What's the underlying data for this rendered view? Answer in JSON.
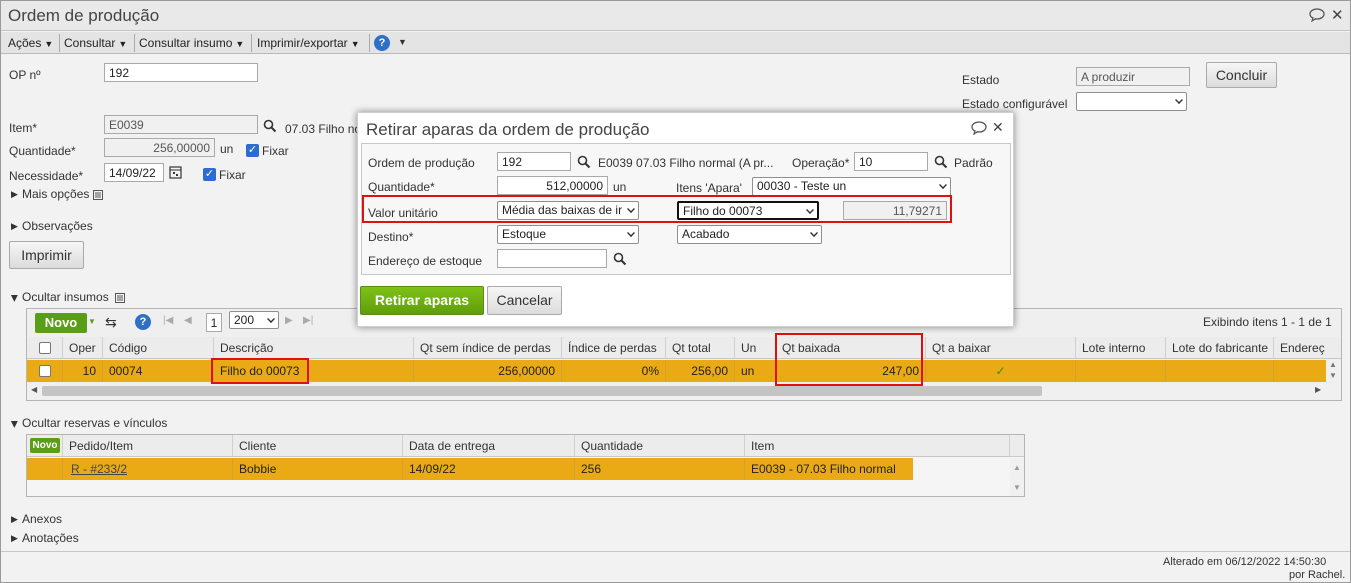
{
  "window": {
    "title": "Ordem de produção"
  },
  "menu": [
    {
      "label": "Ações"
    },
    {
      "label": "Consultar"
    },
    {
      "label": "Consultar insumo"
    },
    {
      "label": "Imprimir/exportar"
    }
  ],
  "form": {
    "op_label": "OP nº",
    "op_value": "192",
    "item_label": "Item*",
    "item_value": "E0039",
    "item_desc": "07.03 Filho no",
    "qty_label": "Quantidade*",
    "qty_value": "256,00000",
    "qty_unit": "un",
    "fixar1": "Fixar",
    "need_label": "Necessidade*",
    "need_value": "14/09/22",
    "fixar2": "Fixar",
    "mais_opcoes": "Mais opções",
    "observacoes": "Observações",
    "imprimir": "Imprimir",
    "estado_label": "Estado",
    "estado_value": "A produzir",
    "estado_conf_label": "Estado configurável",
    "estado_conf_value": "",
    "concluir": "Concluir"
  },
  "insumos": {
    "section": "Ocultar insumos",
    "novo": "Novo",
    "page": "1",
    "page_size": "200",
    "showing": "Exibindo itens 1 - 1 de 1",
    "columns": [
      "Oper",
      "Código",
      "Descrição",
      "Qt sem índice de perdas",
      "Índice de perdas",
      "Qt total",
      "Un",
      "Qt baixada",
      "Qt a baixar",
      "Lote interno",
      "Lote do fabricante",
      "Endereç"
    ],
    "row": {
      "oper": "10",
      "codigo": "00074",
      "descricao": "Filho do 00073",
      "qt_sem": "256,00000",
      "indice": "0%",
      "qt_total": "256,00",
      "un": "un",
      "qt_baixada": "247,00",
      "qt_a_baixar": "✓"
    }
  },
  "reservas": {
    "section": "Ocultar reservas e vínculos",
    "novo": "Novo",
    "columns": [
      "Pedido/Item",
      "Cliente",
      "Data de entrega",
      "Quantidade",
      "Item"
    ],
    "row": {
      "pedido": "R - #233/2",
      "cliente": "Bobbie",
      "data": "14/09/22",
      "quantidade": "256",
      "item": "E0039 - 07.03 Filho normal"
    }
  },
  "anexos": "Anexos",
  "anotacoes": "Anotações",
  "footer": {
    "line1": "Alterado em 06/12/2022 14:50:30",
    "line2": "por Rachel."
  },
  "dialog": {
    "title": "Retirar aparas da ordem de produção",
    "ordem_label": "Ordem de produção",
    "ordem_value": "192",
    "ordem_desc": "E0039 07.03 Filho normal (A pr...",
    "operacao_label": "Operação*",
    "operacao_value": "10",
    "operacao_desc": "Padrão",
    "quantidade_label": "Quantidade*",
    "quantidade_value": "512,00000",
    "quantidade_unit": "un",
    "itens_apara_label": "Itens 'Apara'",
    "itens_apara_value": "00030 - Teste un",
    "valor_label": "Valor unitário",
    "valor_select": "Média das baixas de ir",
    "valor_item": "Filho do 00073",
    "valor_value": "11,79271",
    "destino_label": "Destino*",
    "destino_value": "Estoque",
    "destino_item": "Acabado",
    "endereco_label": "Endereço de estoque",
    "endereco_value": "",
    "retirar": "Retirar aparas",
    "cancelar": "Cancelar"
  },
  "colors": {
    "accent_green": "#5f9e0b",
    "row_highlight": "#e9aa15",
    "red_annotation": "#e01010"
  }
}
